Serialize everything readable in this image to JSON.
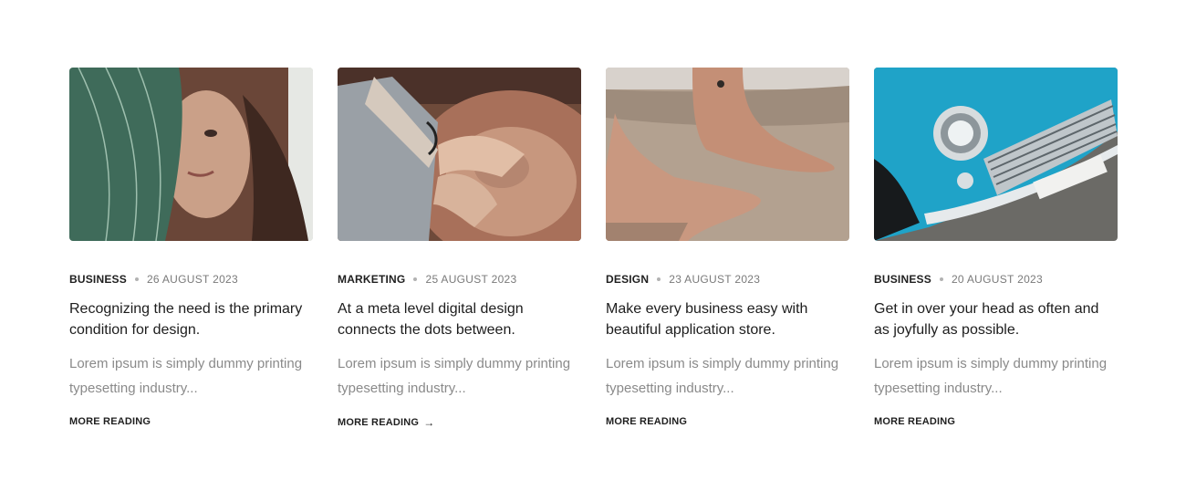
{
  "posts": [
    {
      "category": "BUSINESS",
      "date": "26 AUGUST 2023",
      "title": "Recognizing the need is the primary condition for design.",
      "excerpt": "Lorem ipsum is simply dummy printing typesetting industry...",
      "link": "MORE READING",
      "link_arrow": ""
    },
    {
      "category": "MARKETING",
      "date": "25 AUGUST 2023",
      "title": "At a meta level digital design connects the dots between.",
      "excerpt": "Lorem ipsum is simply dummy printing typesetting industry...",
      "link": "MORE READING",
      "link_arrow": "→"
    },
    {
      "category": "DESIGN",
      "date": "23 AUGUST 2023",
      "title": "Make every business easy with beautiful application store.",
      "excerpt": "Lorem ipsum is simply dummy printing typesetting industry...",
      "link": "MORE READING",
      "link_arrow": ""
    },
    {
      "category": "BUSINESS",
      "date": "20 AUGUST 2023",
      "title": "Get in over your head as often and as joyfully as possible.",
      "excerpt": "Lorem ipsum is simply dummy printing typesetting industry...",
      "link": "MORE READING",
      "link_arrow": ""
    }
  ]
}
